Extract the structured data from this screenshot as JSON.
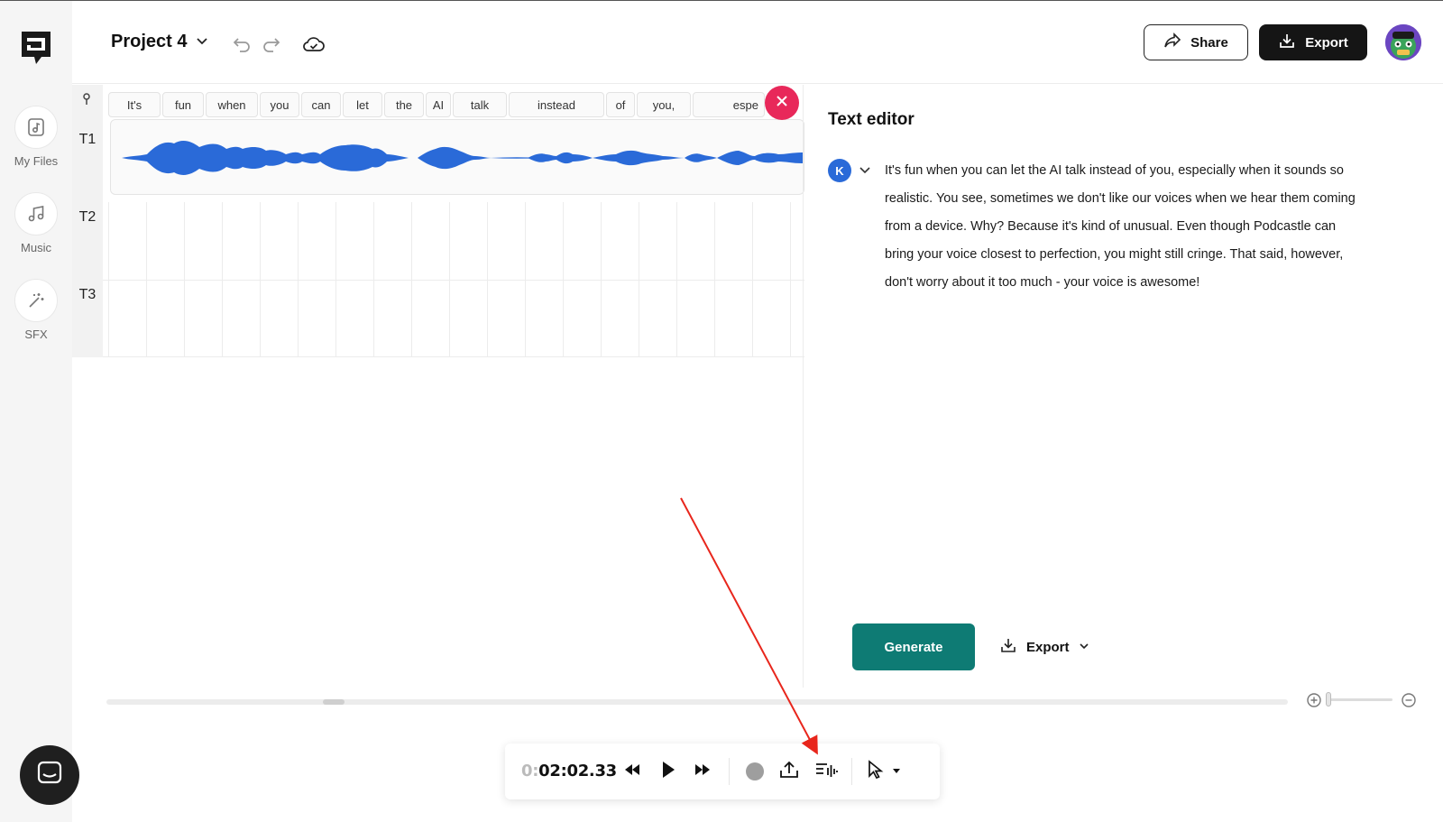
{
  "app": {
    "logo": "podcastle-logo-icon"
  },
  "sidebar": {
    "items": [
      {
        "label": "My Files",
        "icon": "file-music-icon"
      },
      {
        "label": "Music",
        "icon": "music-note-icon"
      },
      {
        "label": "SFX",
        "icon": "magic-wand-icon"
      }
    ],
    "chat_icon": "chat-icon"
  },
  "header": {
    "project_title": "Project 4",
    "share_label": "Share",
    "export_label": "Export"
  },
  "timeline": {
    "tracks": [
      "T1",
      "T2",
      "T3"
    ],
    "words": [
      "It's",
      "fun",
      "when",
      "you",
      "can",
      "let",
      "the",
      "AI",
      "talk",
      "instead",
      "of",
      "you,",
      "espe"
    ],
    "clip_color": "#2a6ad8"
  },
  "text_editor": {
    "title": "Text editor",
    "speaker_initial": "K",
    "text": "It's fun when you can let the AI talk instead of you, especially when it sounds so realistic. You see, sometimes we don't like our voices when we hear them coming from a device. Why? Because it's kind of unusual. Even though Podcastle can bring your voice closest to perfection, you might still cringe. That said, however, don't worry about it too much - your voice is awesome!",
    "generate_label": "Generate",
    "export_label": "Export"
  },
  "transport": {
    "time_prefix": "0:",
    "time_main": "02:02.33"
  },
  "annotation": {
    "arrow_color": "#e8261c"
  },
  "colors": {
    "accent_teal": "#0e7b74",
    "close_red": "#e8285a",
    "dark_button": "#151515"
  }
}
